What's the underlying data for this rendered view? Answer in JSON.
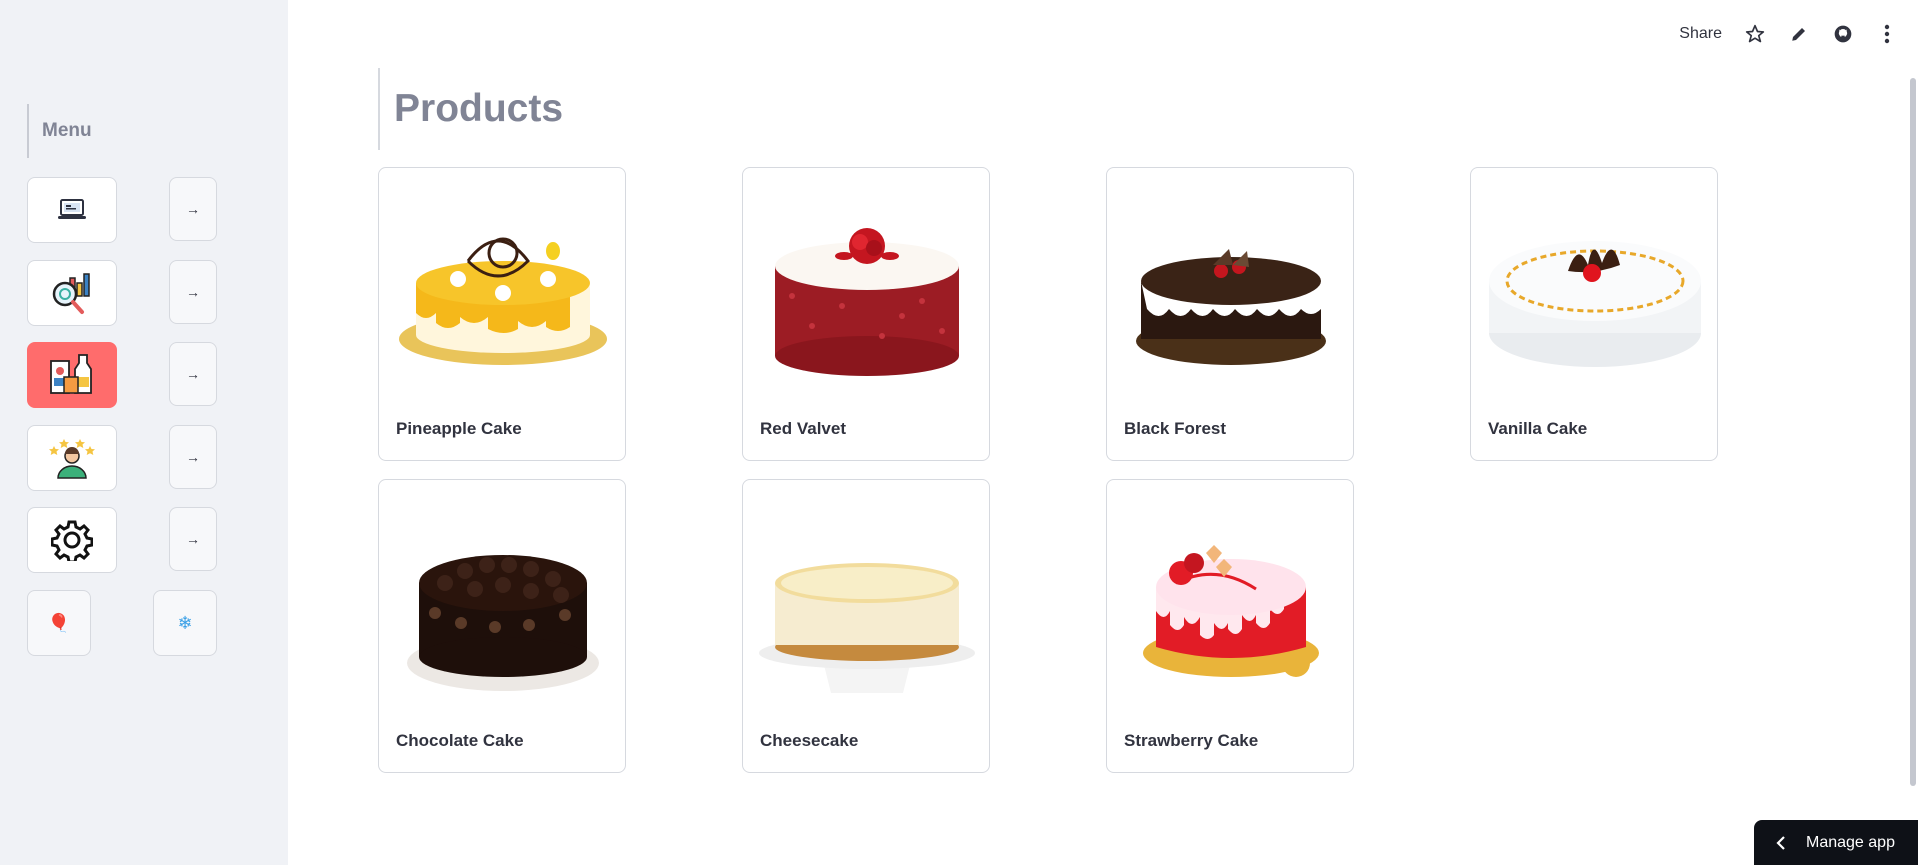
{
  "sidebar": {
    "heading": "Menu",
    "nav_items": [
      {
        "icon": "laptop-icon",
        "arrow": "→",
        "active": false
      },
      {
        "icon": "analytics-icon",
        "arrow": "→",
        "active": false
      },
      {
        "icon": "products-icon",
        "arrow": "→",
        "active": true
      },
      {
        "icon": "reviews-icon",
        "arrow": "→",
        "active": false
      },
      {
        "icon": "gear-icon",
        "arrow": "→",
        "active": false
      }
    ],
    "extra_buttons": [
      {
        "icon": "balloon-icon",
        "glyph": "🎈"
      },
      {
        "icon": "snowflake-icon",
        "glyph": "❄"
      }
    ],
    "active_color": "#ff6c6c"
  },
  "toolbar": {
    "share_label": "Share",
    "icons": [
      "star-icon",
      "pencil-icon",
      "github-icon",
      "more-vert-icon"
    ]
  },
  "main": {
    "title": "Products",
    "products": [
      {
        "name": "Pineapple Cake",
        "image": "pineapple-cake-image"
      },
      {
        "name": "Red Valvet",
        "image": "red-velvet-cake-image"
      },
      {
        "name": "Black Forest",
        "image": "black-forest-cake-image"
      },
      {
        "name": "Vanilla Cake",
        "image": "vanilla-cake-image"
      },
      {
        "name": "Chocolate Cake",
        "image": "chocolate-cake-image"
      },
      {
        "name": "Cheesecake",
        "image": "cheesecake-image"
      },
      {
        "name": "Strawberry Cake",
        "image": "strawberry-cake-image"
      }
    ]
  },
  "footer": {
    "manage_app_label": "Manage app"
  }
}
